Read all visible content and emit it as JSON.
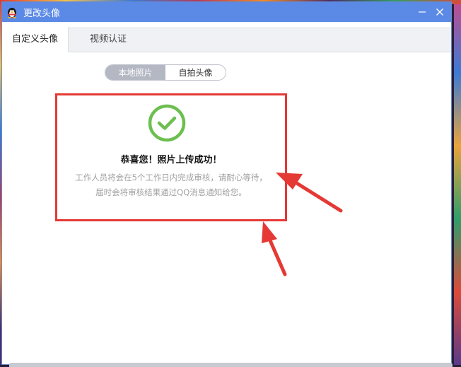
{
  "window": {
    "title": "更改头像",
    "app_icon": "qq-penguin-icon",
    "title_bar_color": "#5b8ae6"
  },
  "tabs": [
    {
      "label": "自定义头像",
      "active": true
    },
    {
      "label": "视频认证",
      "active": false
    }
  ],
  "segmented": {
    "options": [
      {
        "label": "本地照片",
        "active": true
      },
      {
        "label": "自拍头像",
        "active": false
      }
    ]
  },
  "success": {
    "icon": "check-circle-icon",
    "icon_color": "#6cbf4f",
    "title": "恭喜您！照片上传成功！",
    "desc_line1": "工作人员将会在5个工作日内完成审核，请耐心等待，",
    "desc_line2": "届时会将审核结果通过QQ消息通知给您。"
  },
  "annotation": {
    "highlight_color": "#e53935"
  }
}
